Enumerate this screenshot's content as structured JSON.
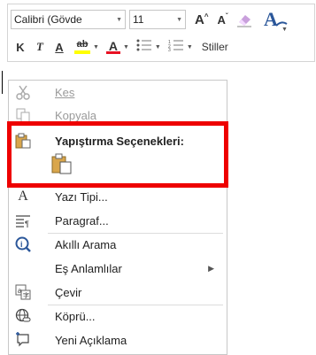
{
  "mini_toolbar": {
    "font_name": "Calibri (Gövde",
    "font_size": "11",
    "grow_font": "A",
    "shrink_font": "A",
    "styles_label": "Stiller",
    "bold_label": "K",
    "italic_label": "T",
    "underline_label": "A",
    "highlight_label": "ab",
    "font_color_label": "A",
    "font_color": "#e81123",
    "highlight_color": "#ffff00"
  },
  "context_menu": {
    "cut": "Kes",
    "copy": "Kopyala",
    "paste_options_heading": "Yapıştırma Seçenekleri:",
    "font": "Yazı Tipi...",
    "paragraph": "Paragraf...",
    "smart_lookup": "Akıllı Arama",
    "synonyms": "Eş Anlamlılar",
    "translate": "Çevir",
    "link": "Köprü...",
    "new_comment": "Yeni Açıklama"
  },
  "colors": {
    "highlight_box": "#ee0000",
    "accent_blue": "#2b579a"
  }
}
